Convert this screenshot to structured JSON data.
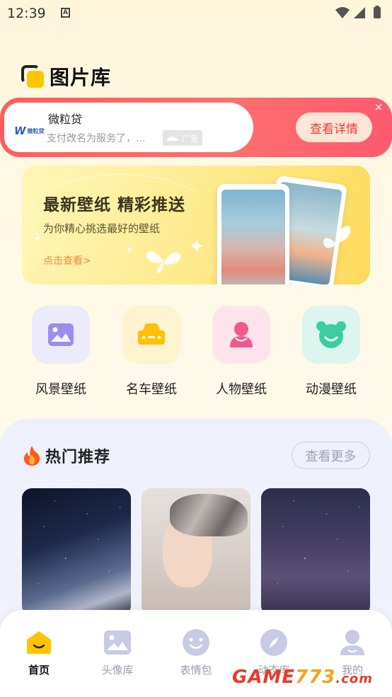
{
  "status_bar": {
    "time": "12:39",
    "notification_icon": "A"
  },
  "header": {
    "title": "图片库"
  },
  "ad": {
    "brand_logo_text": "微粒贷",
    "name": "微粒贷",
    "description": "支付改名为服务了，...",
    "tag": "广告",
    "cta": "查看详情",
    "close": "×"
  },
  "promo": {
    "title": "最新壁纸 精彩推送",
    "subtitle": "为你精心挑选最好的壁纸",
    "link": "点击查看>"
  },
  "categories": [
    {
      "label": "风景壁纸",
      "icon": "landscape-icon",
      "bg": "#ecebfb",
      "color": "#9b8cf0"
    },
    {
      "label": "名车壁纸",
      "icon": "car-icon",
      "bg": "#fff3d0",
      "color": "#ffc107"
    },
    {
      "label": "人物壁纸",
      "icon": "person-icon",
      "bg": "#ffe3ec",
      "color": "#f3588a"
    },
    {
      "label": "动漫壁纸",
      "icon": "bear-icon",
      "bg": "#dcf5ee",
      "color": "#3dcea0"
    }
  ],
  "hot": {
    "title": "热门推荐",
    "more": "查看更多"
  },
  "nav": {
    "items": [
      {
        "label": "首页",
        "icon": "home-icon",
        "active": true
      },
      {
        "label": "头像库",
        "icon": "image-icon",
        "active": false
      },
      {
        "label": "表情包",
        "icon": "smile-icon",
        "active": false
      },
      {
        "label": "动态库",
        "icon": "compass-icon",
        "active": false
      },
      {
        "label": "我的",
        "icon": "user-icon",
        "active": false
      }
    ]
  },
  "watermark": {
    "part1": "GAME",
    "part2": "773",
    "part3": ".com"
  },
  "colors": {
    "accent": "#ffc400",
    "ad_red": "#ff5d5d",
    "cta_text": "#e2403d"
  }
}
